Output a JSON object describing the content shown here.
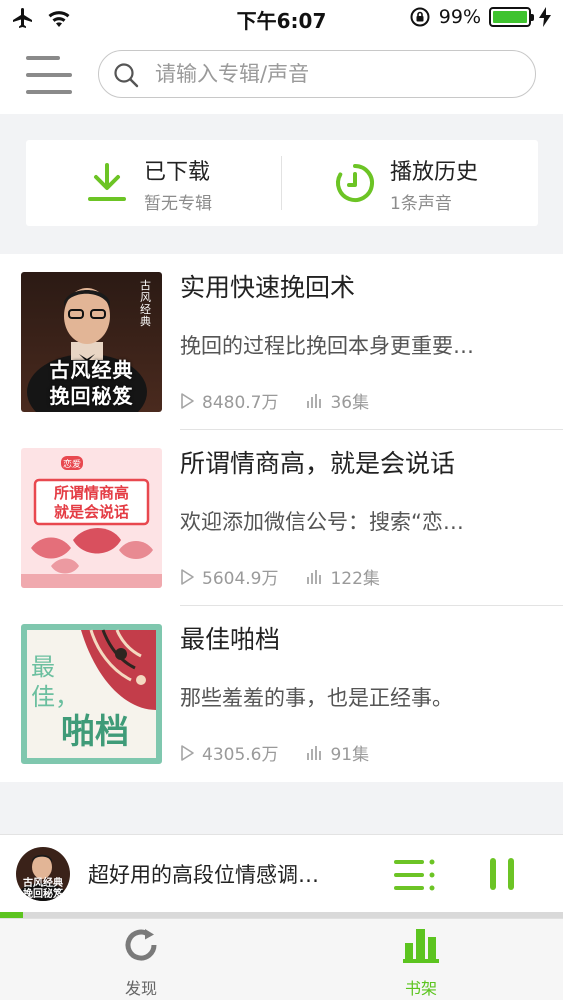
{
  "status_bar": {
    "time": "下午6:07",
    "battery": "99%",
    "battery_level": 0.99
  },
  "search": {
    "placeholder": "请输入专辑/声音"
  },
  "quick_actions": [
    {
      "title": "已下载",
      "subtitle": "暂无专辑",
      "icon": "download-icon"
    },
    {
      "title": "播放历史",
      "subtitle": "1条声音",
      "icon": "history-icon"
    }
  ],
  "albums": [
    {
      "title": "实用快速挽回术",
      "description": "挽回的过程比挽回本身更重要…",
      "plays": "8480.7万",
      "episodes": "36集",
      "cover_text": [
        "古风经典",
        "挽回秘笈"
      ],
      "cover_side_text": "古风经典"
    },
    {
      "title": "所谓情商高，就是会说话",
      "description": "欢迎添加微信公号：搜索“恋…",
      "plays": "5604.9万",
      "episodes": "122集",
      "cover_text": [
        "所谓情商高",
        "就是会说话"
      ],
      "cover_badge": "恋爱"
    },
    {
      "title": "最佳啪档",
      "description": "那些羞羞的事，也是正经事。",
      "plays": "4305.6万",
      "episodes": "91集",
      "cover_text": [
        "最佳，",
        "啪档"
      ]
    }
  ],
  "player": {
    "now_playing": "超好用的高段位情感调…",
    "progress": 0.04,
    "avatar_text": [
      "古风经典",
      "挽回秘笈"
    ]
  },
  "tabs": [
    {
      "label": "发现",
      "icon": "refresh-icon",
      "active": false
    },
    {
      "label": "书架",
      "icon": "bookshelf-icon",
      "active": true
    }
  ],
  "colors": {
    "accent": "#5cc41f",
    "battery": "#3fc32f"
  }
}
